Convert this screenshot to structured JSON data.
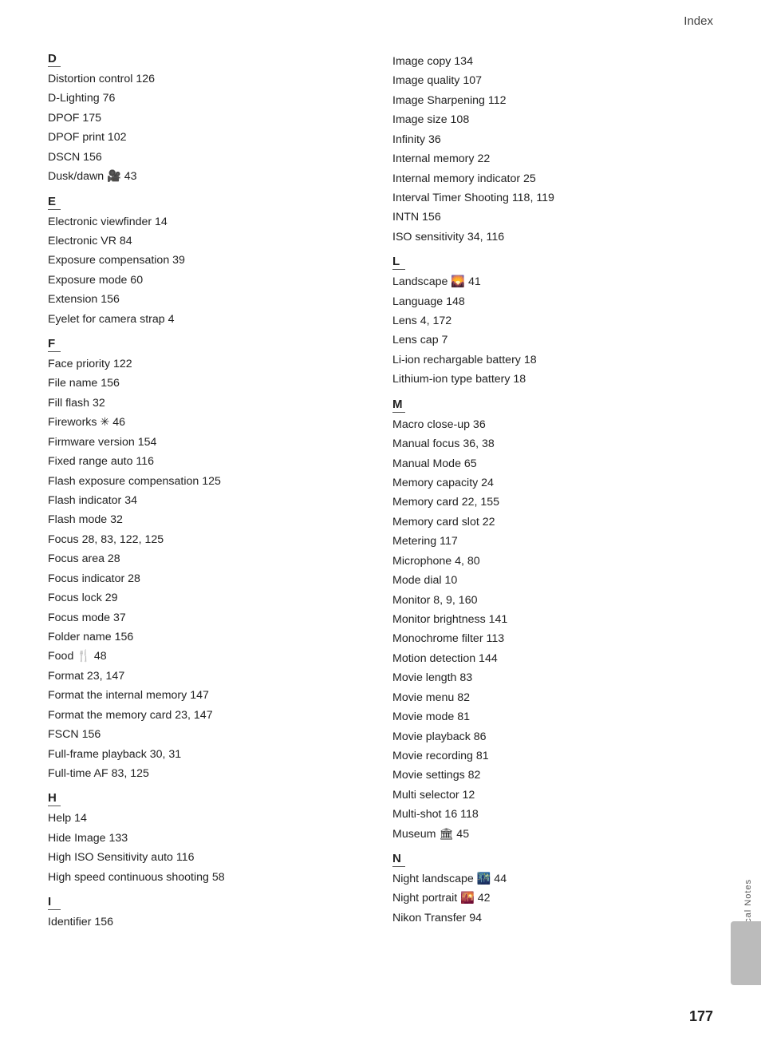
{
  "header": {
    "title": "Index"
  },
  "page_number": "177",
  "side_label": "Technical Notes",
  "left_column": {
    "sections": [
      {
        "letter": "D",
        "items": [
          "Distortion control 126",
          "D-Lighting 76",
          "DPOF 175",
          "DPOF print 102",
          "DSCN 156",
          "Dusk/dawn 🎥 43"
        ]
      },
      {
        "letter": "E",
        "items": [
          "Electronic viewfinder 14",
          "Electronic VR 84",
          "Exposure compensation 39",
          "Exposure mode 60",
          "Extension 156",
          "Eyelet for camera strap 4"
        ]
      },
      {
        "letter": "F",
        "items": [
          "Face priority 122",
          "File name 156",
          "Fill flash 32",
          "Fireworks ✳ 46",
          "Firmware version 154",
          "Fixed range auto 116",
          "Flash exposure compensation 125",
          "Flash indicator 34",
          "Flash mode 32",
          "Focus 28, 83, 122, 125",
          "Focus area 28",
          "Focus indicator 28",
          "Focus lock 29",
          "Focus mode 37",
          "Folder name 156",
          "Food 🍴 48",
          "Format 23, 147",
          "Format the internal memory 147",
          "Format the memory card 23, 147",
          "FSCN 156",
          "Full-frame playback 30, 31",
          "Full-time AF 83, 125"
        ]
      },
      {
        "letter": "H",
        "items": [
          "Help 14",
          "Hide Image 133",
          "High ISO Sensitivity auto 116",
          "High speed continuous shooting 58"
        ]
      },
      {
        "letter": "I",
        "items": [
          "Identifier 156"
        ]
      }
    ]
  },
  "right_column": {
    "sections": [
      {
        "letter": "",
        "items": [
          "Image copy 134",
          "Image quality 107",
          "Image Sharpening 112",
          "Image size 108",
          "Infinity 36",
          "Internal memory 22",
          "Internal memory indicator 25",
          "Interval Timer Shooting 118, 119",
          "INTN 156",
          "ISO sensitivity 34, 116"
        ]
      },
      {
        "letter": "L",
        "items": [
          "Landscape 🌄 41",
          "Language 148",
          "Lens 4, 172",
          "Lens cap 7",
          "Li-ion rechargable battery 18",
          "Lithium-ion type battery 18"
        ]
      },
      {
        "letter": "M",
        "items": [
          "Macro close-up 36",
          "Manual focus 36, 38",
          "Manual Mode 65",
          "Memory capacity 24",
          "Memory card 22, 155",
          "Memory card slot 22",
          "Metering 117",
          "Microphone 4, 80",
          "Mode dial 10",
          "Monitor 8, 9, 160",
          "Monitor brightness 141",
          "Monochrome filter 113",
          "Motion detection 144",
          "Movie length 83",
          "Movie menu 82",
          "Movie mode 81",
          "Movie playback 86",
          "Movie recording 81",
          "Movie settings 82",
          "Multi selector 12",
          "Multi-shot 16 118",
          "Museum 🏛 45"
        ]
      },
      {
        "letter": "N",
        "items": [
          "Night landscape 🌃 44",
          "Night portrait 🌇 42",
          "Nikon Transfer 94"
        ]
      }
    ]
  }
}
